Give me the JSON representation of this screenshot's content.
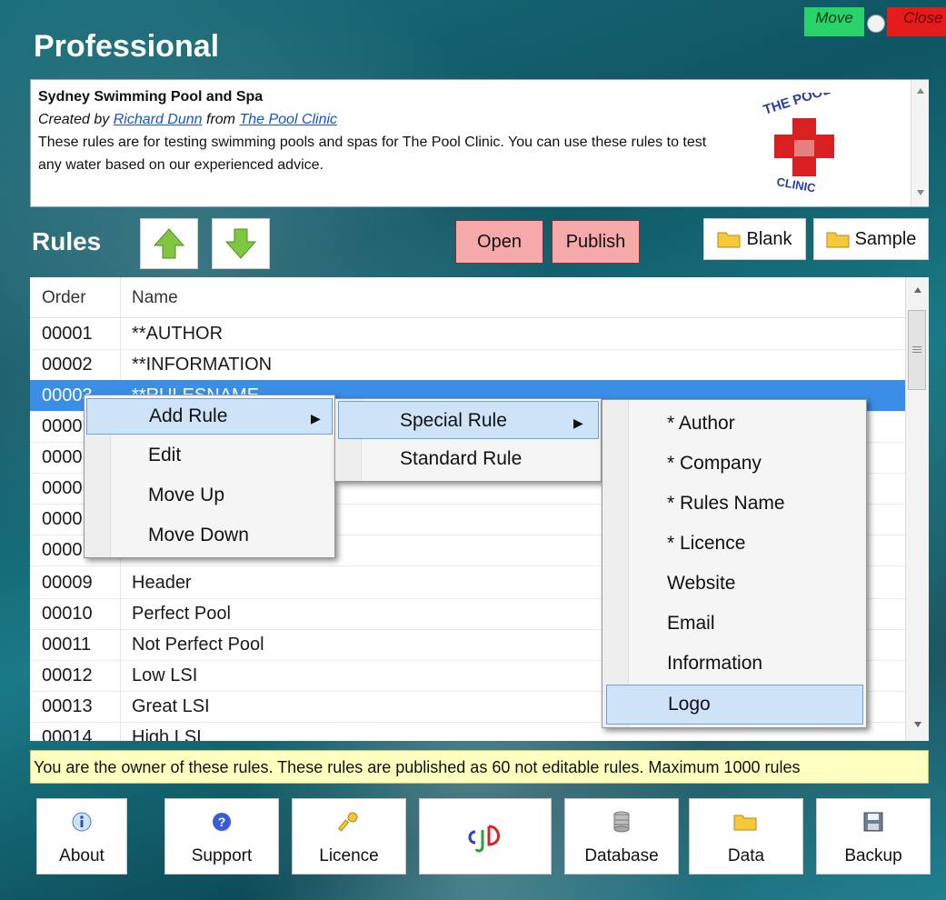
{
  "window": {
    "move_label": "Move",
    "close_label": "Close"
  },
  "header": {
    "title": "Professional"
  },
  "description": {
    "title": "Sydney Swimming Pool and Spa",
    "created_prefix": "Created by",
    "author": "Richard Dunn",
    "from_label": "from",
    "company": "The Pool Clinic",
    "body": "These rules are for testing swimming pools and spas for The Pool Clinic. You can use these rules to test any water based on our experienced advice.",
    "logo_text_top": "THE POOL",
    "logo_text_bottom": "CLINIC"
  },
  "rules_section": {
    "label": "Rules",
    "open_label": "Open",
    "publish_label": "Publish",
    "blank_label": "Blank",
    "sample_label": "Sample"
  },
  "table": {
    "columns": [
      "Order",
      "Name"
    ],
    "rows": [
      {
        "order": "00001",
        "name": "**AUTHOR"
      },
      {
        "order": "00002",
        "name": "**INFORMATION"
      },
      {
        "order": "00003",
        "name": "**RULESNAME"
      },
      {
        "order": "0000",
        "name": ""
      },
      {
        "order": "0000",
        "name": ""
      },
      {
        "order": "0000",
        "name": ""
      },
      {
        "order": "0000",
        "name": ""
      },
      {
        "order": "0000",
        "name": ""
      },
      {
        "order": "00009",
        "name": "Header"
      },
      {
        "order": "00010",
        "name": "Perfect Pool"
      },
      {
        "order": "00011",
        "name": "Not Perfect Pool"
      },
      {
        "order": "00012",
        "name": "Low LSI"
      },
      {
        "order": "00013",
        "name": "Great LSI"
      },
      {
        "order": "00014",
        "name": "High LSI"
      }
    ]
  },
  "context_menu": {
    "items": [
      "Add Rule",
      "Edit",
      "Move Up",
      "Move Down"
    ],
    "submenu": [
      "Special Rule",
      "Standard Rule"
    ],
    "special_items": [
      "* Author",
      "* Company",
      "* Rules Name",
      "* Licence",
      "Website",
      "Email",
      "Information",
      "Logo"
    ]
  },
  "status": {
    "text": "You are the owner of these rules. These rules are published as 60 not editable rules. Maximum 1000 rules"
  },
  "bottom_buttons": {
    "about": "About",
    "support": "Support",
    "licence": "Licence",
    "database": "Database",
    "data": "Data",
    "backup": "Backup"
  },
  "colors": {
    "selection": "#3a8ee6",
    "status_bg": "#ffffc0",
    "pink_button": "#f5a9a9",
    "move_green": "#29d36a",
    "close_red": "#e31b1b"
  }
}
